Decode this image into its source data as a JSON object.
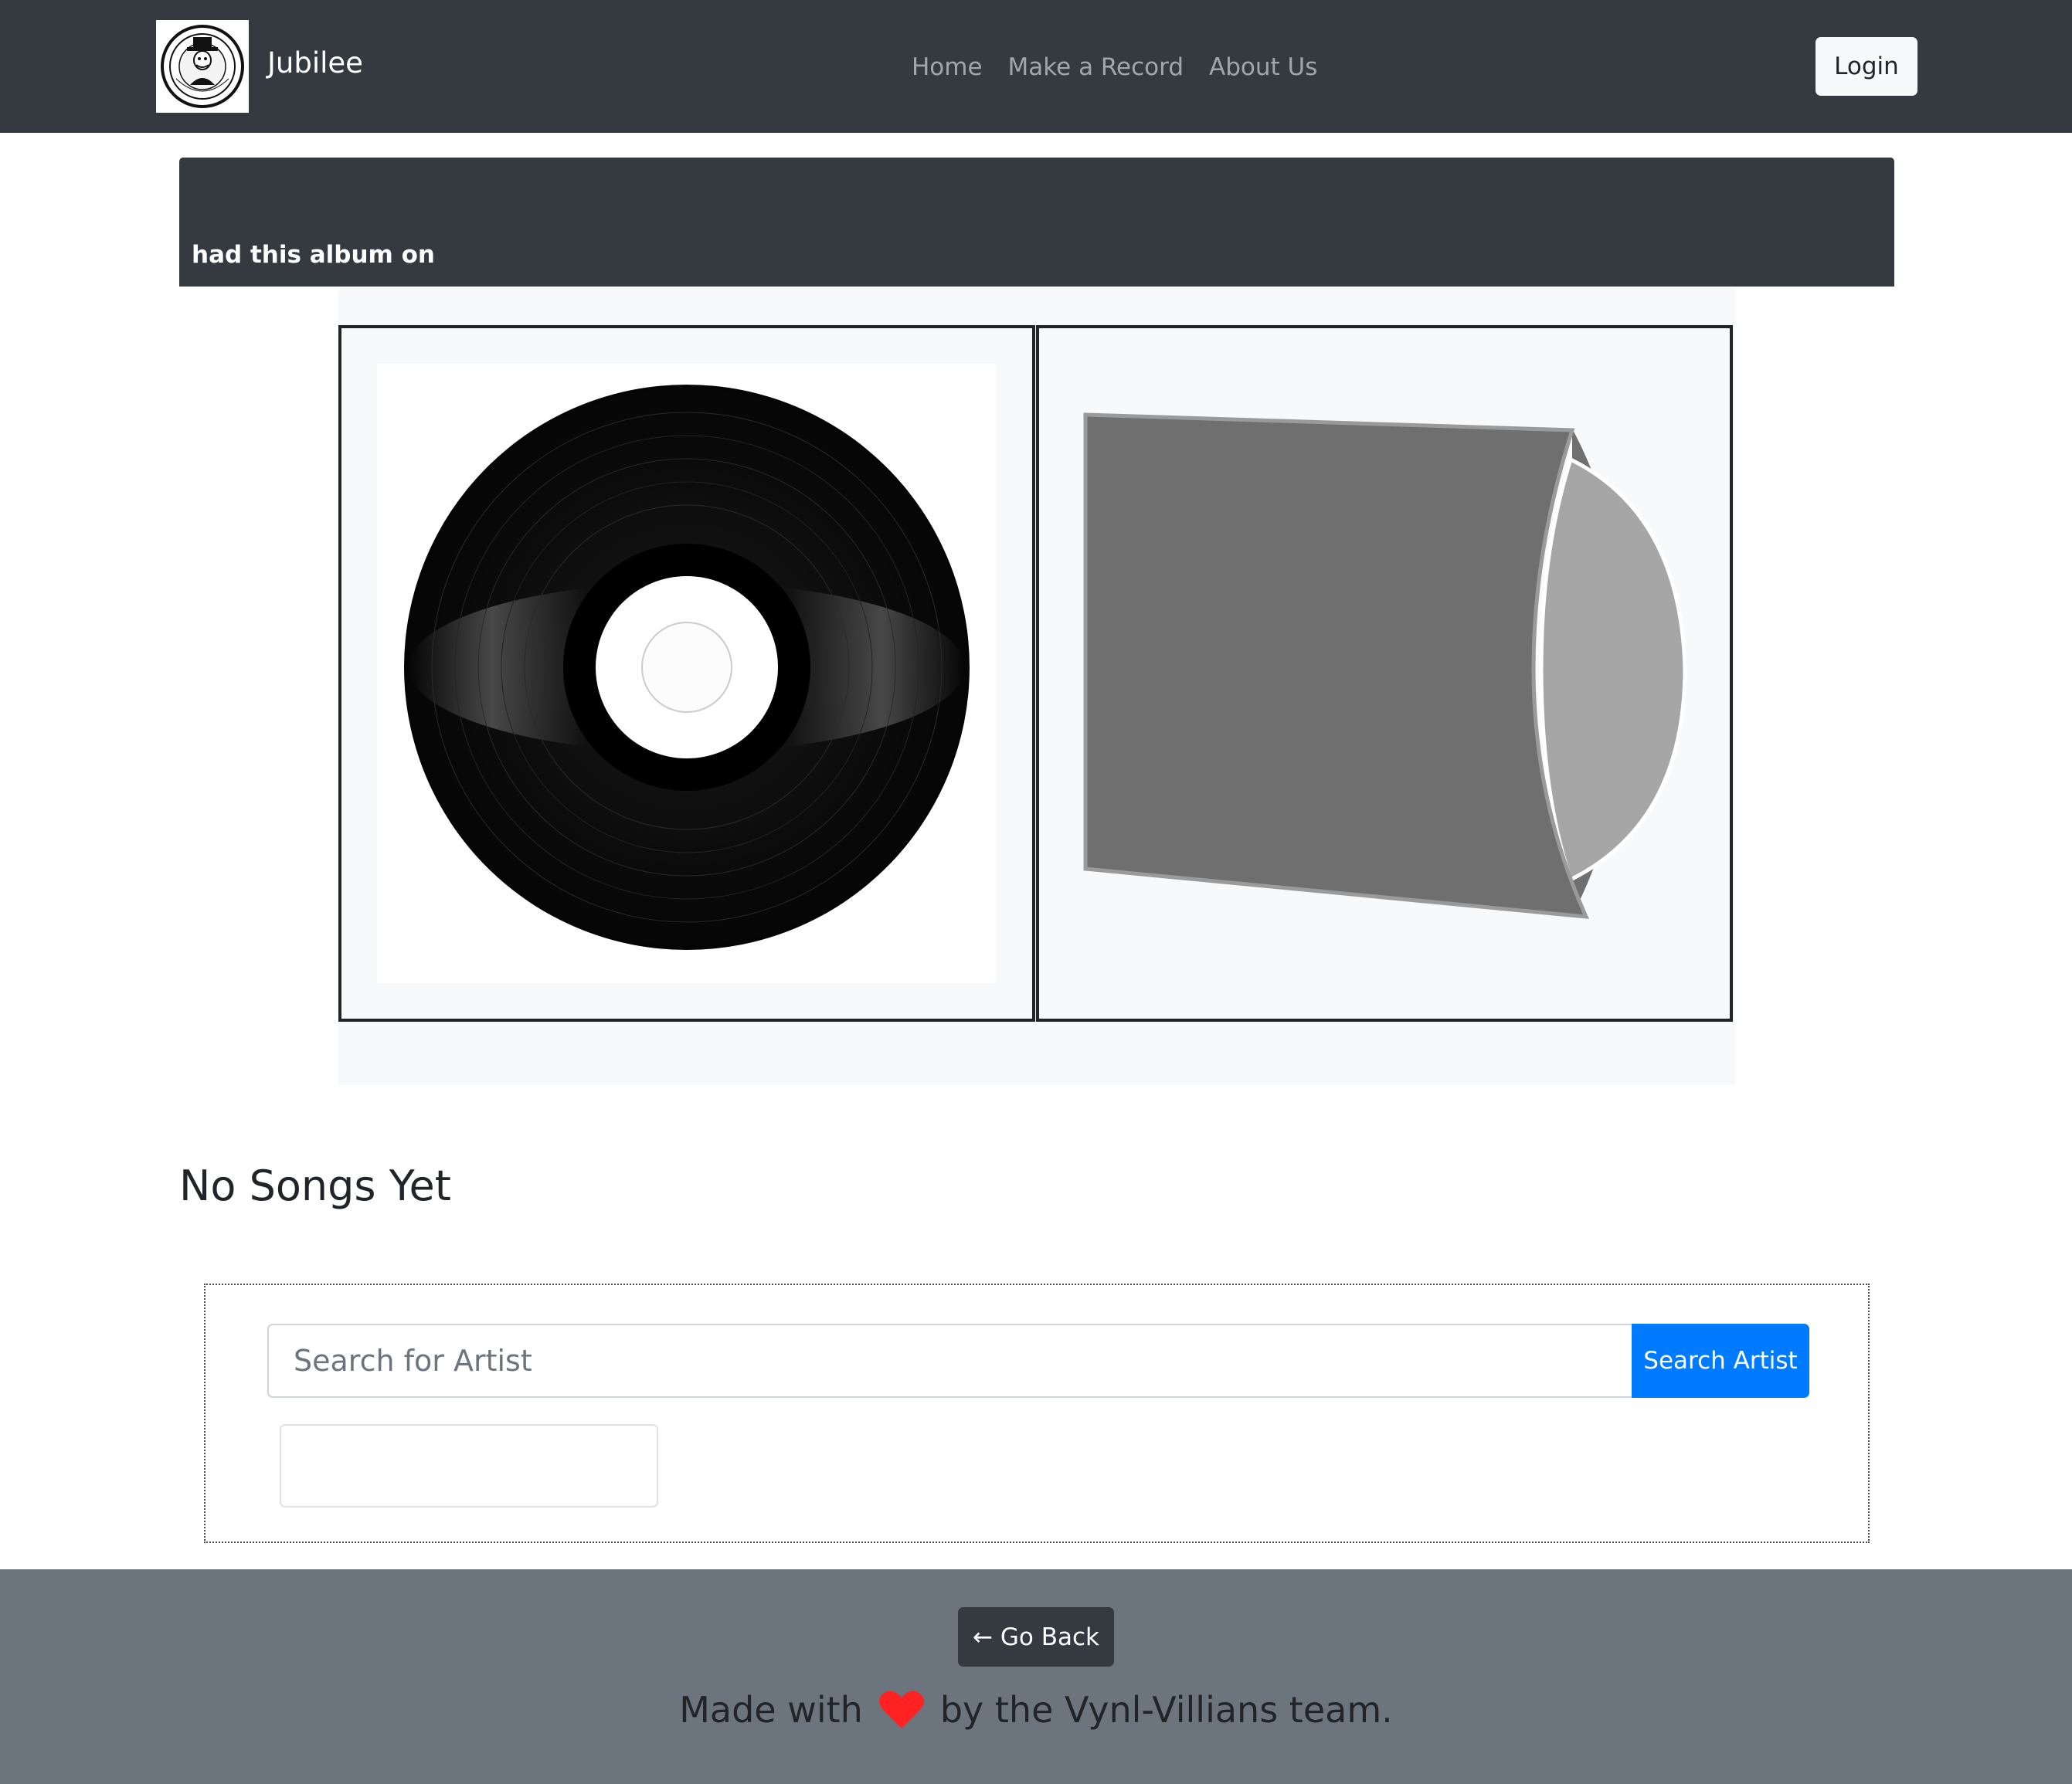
{
  "navbar": {
    "brand_name": "Jubilee",
    "logo": {
      "icon": "vynl-villains-logo-icon",
      "text": "VYNL VILLAINS"
    },
    "links": [
      {
        "label": "Home"
      },
      {
        "label": "Make a Record"
      },
      {
        "label": "About Us"
      }
    ],
    "login_label": "Login",
    "background_color": "#343a40"
  },
  "album": {
    "subtitle": "had this album on",
    "record_image": {
      "icon": "vinyl-record-icon"
    },
    "sleeve_image": {
      "icon": "record-sleeve-icon"
    }
  },
  "songs": {
    "heading": "No Songs Yet"
  },
  "search": {
    "placeholder": "Search for Artist",
    "value": "",
    "button_label": "Search Artist",
    "button_color": "#007bff"
  },
  "footer": {
    "go_back_label": "← Go Back",
    "made_with": "Made with",
    "team_text": "by the Vynl-Villians team.",
    "heart_icon": "heart-icon",
    "heart_color": "#ff2222",
    "background_color": "#6c757d"
  }
}
